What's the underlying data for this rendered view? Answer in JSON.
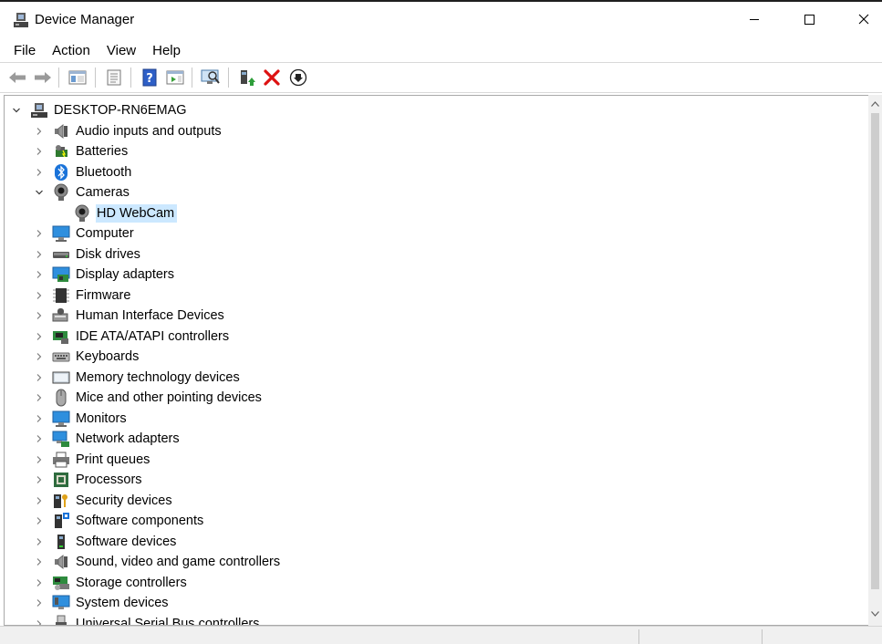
{
  "window": {
    "title": "Device Manager"
  },
  "menu": [
    "File",
    "Action",
    "View",
    "Help"
  ],
  "toolbar": {
    "buttons": [
      "back-icon",
      "forward-icon",
      "show-hide-console-tree-icon",
      "properties-icon",
      "help-icon",
      "action-pane-icon",
      "scan-hardware-icon",
      "update-driver-icon",
      "uninstall-device-icon",
      "disable-device-icon"
    ]
  },
  "tree": {
    "root": "DESKTOP-RN6EMAG",
    "items": [
      {
        "label": "Audio inputs and outputs",
        "icon": "speaker-icon",
        "expanded": false
      },
      {
        "label": "Batteries",
        "icon": "battery-icon",
        "expanded": false
      },
      {
        "label": "Bluetooth",
        "icon": "bluetooth-icon",
        "expanded": false
      },
      {
        "label": "Cameras",
        "icon": "camera-icon",
        "expanded": true,
        "children": [
          {
            "label": "HD WebCam",
            "icon": "webcam-icon",
            "selected": true
          }
        ]
      },
      {
        "label": "Computer",
        "icon": "computer-icon",
        "expanded": false
      },
      {
        "label": "Disk drives",
        "icon": "disk-drive-icon",
        "expanded": false
      },
      {
        "label": "Display adapters",
        "icon": "display-adapter-icon",
        "expanded": false
      },
      {
        "label": "Firmware",
        "icon": "firmware-chip-icon",
        "expanded": false
      },
      {
        "label": "Human Interface Devices",
        "icon": "hid-icon",
        "expanded": false
      },
      {
        "label": "IDE ATA/ATAPI controllers",
        "icon": "ide-controller-icon",
        "expanded": false
      },
      {
        "label": "Keyboards",
        "icon": "keyboard-icon",
        "expanded": false
      },
      {
        "label": "Memory technology devices",
        "icon": "memory-device-icon",
        "expanded": false
      },
      {
        "label": "Mice and other pointing devices",
        "icon": "mouse-icon",
        "expanded": false
      },
      {
        "label": "Monitors",
        "icon": "monitor-icon",
        "expanded": false
      },
      {
        "label": "Network adapters",
        "icon": "network-adapter-icon",
        "expanded": false
      },
      {
        "label": "Print queues",
        "icon": "printer-icon",
        "expanded": false
      },
      {
        "label": "Processors",
        "icon": "processor-icon",
        "expanded": false
      },
      {
        "label": "Security devices",
        "icon": "security-device-icon",
        "expanded": false
      },
      {
        "label": "Software components",
        "icon": "software-component-icon",
        "expanded": false
      },
      {
        "label": "Software devices",
        "icon": "software-device-icon",
        "expanded": false
      },
      {
        "label": "Sound, video and game controllers",
        "icon": "sound-controller-icon",
        "expanded": false
      },
      {
        "label": "Storage controllers",
        "icon": "storage-controller-icon",
        "expanded": false
      },
      {
        "label": "System devices",
        "icon": "system-device-icon",
        "expanded": false
      },
      {
        "label": "Universal Serial Bus controllers",
        "icon": "usb-icon",
        "expanded": false
      }
    ]
  }
}
